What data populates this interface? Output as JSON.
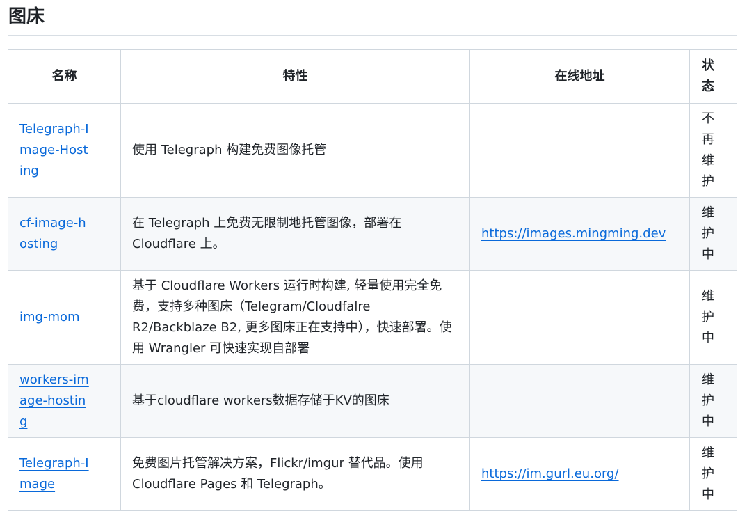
{
  "page": {
    "title": "图床"
  },
  "table": {
    "headers": [
      "名称",
      "特性",
      "在线地址",
      "状态"
    ],
    "rows": [
      {
        "name": "Telegraph-Image-Hosting",
        "feature": "使用 Telegraph 构建免费图像托管",
        "url": "",
        "status": "不再维护"
      },
      {
        "name": "cf-image-hosting",
        "feature": "在 Telegraph 上免费无限制地托管图像，部署在 Cloudflare 上。",
        "url": "https://images.mingming.dev",
        "status": "维护中"
      },
      {
        "name": "img-mom",
        "feature": "基于 Cloudflare Workers 运行时构建, 轻量使用完全免费，支持多种图床（Telegram/Cloudfalre R2/Backblaze B2, 更多图床正在支持中），快速部署。使用 Wrangler 可快速实现自部署",
        "url": "",
        "status": "维护中"
      },
      {
        "name": "workers-image-hosting",
        "feature": "基于cloudflare workers数据存储于KV的图床",
        "url": "",
        "status": "维护中"
      },
      {
        "name": "Telegraph-Image",
        "feature": "免费图片托管解决方案，Flickr/imgur 替代品。使用 Cloudflare Pages 和 Telegraph。",
        "url": "https://im.gurl.eu.org/",
        "status": "维护中"
      }
    ]
  }
}
